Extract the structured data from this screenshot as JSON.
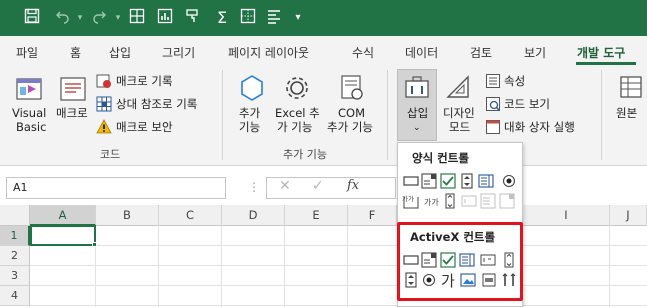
{
  "quick_access": {
    "icons": [
      "save-icon",
      "undo-icon",
      "redo-icon",
      "table-icon",
      "chart-icon",
      "format-painter-icon",
      "autosum-icon",
      "border-icon",
      "align-icon",
      "dropdown-icon"
    ]
  },
  "tabs": [
    "파일",
    "홈",
    "삽입",
    "그리기",
    "페이지 레이아웃",
    "수식",
    "데이터",
    "검토",
    "보기",
    "개발 도구"
  ],
  "active_tab": "개발 도구",
  "ribbon": {
    "code_group": {
      "label": "코드",
      "visual_basic": [
        "Visual",
        "Basic"
      ],
      "macro": "매크로",
      "record_macro": "매크로 기록",
      "relative_ref": "상대 참조로 기록",
      "macro_security": "매크로 보안"
    },
    "addins_group": {
      "label": "추가 기능",
      "addins": [
        "추가",
        "기능"
      ],
      "excel_addins": [
        "Excel 추",
        "가 기능"
      ],
      "com_addins": [
        "COM",
        "추가 기능"
      ]
    },
    "controls_group": {
      "insert": "삽입",
      "design_mode": [
        "디자인",
        "모드"
      ],
      "properties": "속성",
      "view_code": "코드 보기",
      "run_dialog": "대화 상자 실행"
    },
    "source": "원본"
  },
  "formula_bar": {
    "name_box": "A1",
    "fx": "fx"
  },
  "grid": {
    "columns": [
      "A",
      "B",
      "C",
      "D",
      "E",
      "F",
      "I",
      "J"
    ],
    "rows": [
      "1",
      "2",
      "3",
      "4"
    ]
  },
  "insert_popup": {
    "form_controls_title": "양식 컨트롤",
    "activex_title": "ActiveX 컨트롤",
    "label_char": "가",
    "mini_labels": [
      "가가",
      "가가"
    ]
  },
  "colors": {
    "accent": "#217346",
    "highlight": "#e0141e"
  }
}
